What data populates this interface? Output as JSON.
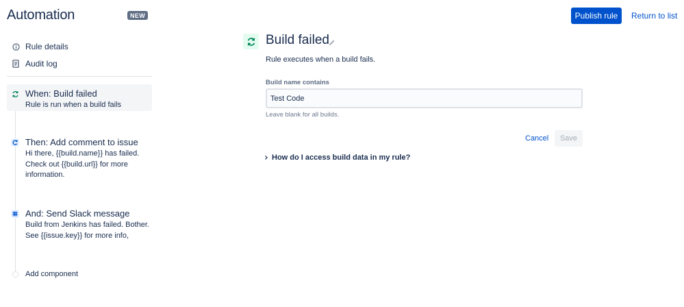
{
  "header": {
    "app_title": "Automation",
    "badge": "NEW",
    "publish_label": "Publish rule",
    "return_label": "Return to list"
  },
  "sidebar": {
    "links": [
      {
        "label": "Rule details",
        "icon": "info-icon"
      },
      {
        "label": "Audit log",
        "icon": "document-icon"
      }
    ],
    "steps": [
      {
        "title": "When: Build failed",
        "desc": "Rule is run when a build fails",
        "icon": "refresh-icon",
        "color": "#00875a"
      },
      {
        "title": "Then: Add comment to issue",
        "desc": "Hi there, {{build.name}} has failed. Check out {{build.url}} for more information.",
        "icon": "comment-action-icon",
        "color": "#0052cc"
      },
      {
        "title": "And: Send Slack message",
        "desc": "Build from Jenkins has failed. Bother. See {{issue.key}} for more info,",
        "icon": "slack-icon",
        "color": "#0052cc"
      }
    ],
    "add_component": "Add component"
  },
  "main": {
    "title": "Build failed",
    "subtitle": "Rule executes when a build fails.",
    "field_label": "Build name contains",
    "field_value": "Test Code",
    "field_help": "Leave blank for all builds.",
    "cancel_label": "Cancel",
    "save_label": "Save",
    "accordion_label": "How do I access build data in my rule?"
  },
  "colors": {
    "accent": "#0052cc",
    "trigger_green": "#00875a",
    "text": "#172b4d"
  }
}
